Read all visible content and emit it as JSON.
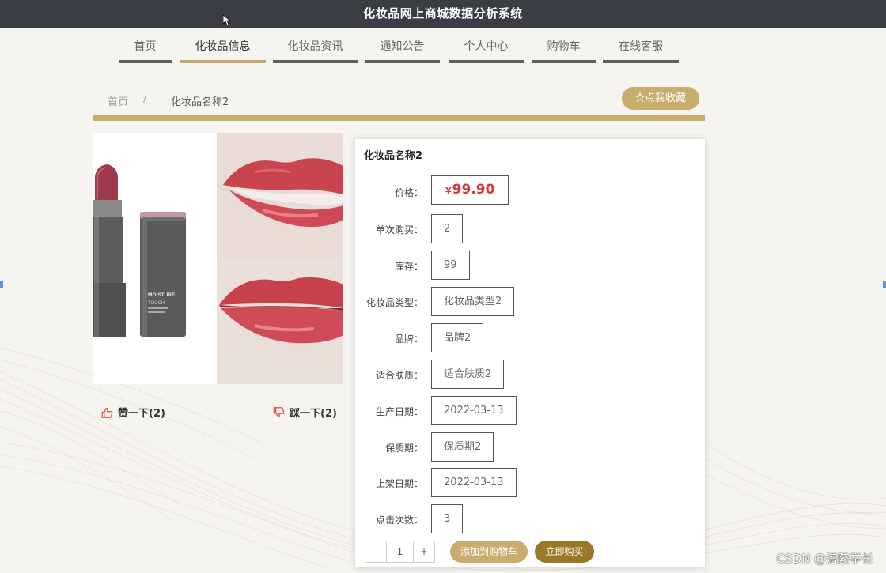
{
  "app": {
    "title": "化妆品网上商城数据分析系统"
  },
  "nav": {
    "items": [
      {
        "label": "首页"
      },
      {
        "label": "化妆品信息"
      },
      {
        "label": "化妆品资讯"
      },
      {
        "label": "通知公告"
      },
      {
        "label": "个人中心"
      },
      {
        "label": "购物车"
      },
      {
        "label": "在线客服"
      }
    ],
    "active_index": 1
  },
  "breadcrumb": {
    "home": "首页",
    "separator": "/",
    "current": "化妆品名称2"
  },
  "favorite_button": {
    "icon": "star-outline-icon",
    "label": "点我收藏"
  },
  "gallery": {
    "left_image": "lipstick-product-photo",
    "right_image": "lips-swatch-photo",
    "product_text": [
      "MOISTURE",
      "TOUCH"
    ]
  },
  "votes": {
    "like": {
      "icon": "thumbs-up-icon",
      "label": "赞一下(2)"
    },
    "dislike": {
      "icon": "thumbs-down-icon",
      "label": "踩一下(2)"
    }
  },
  "product": {
    "name": "化妆品名称2",
    "price": {
      "label": "价格：",
      "currency": "¥",
      "value": "99.90"
    },
    "fields": [
      {
        "label": "单次购买：",
        "value": "2"
      },
      {
        "label": "库存：",
        "value": "99"
      },
      {
        "label": "化妆品类型：",
        "value": "化妆品类型2"
      },
      {
        "label": "品牌：",
        "value": "品牌2"
      },
      {
        "label": "适合肤质：",
        "value": "适合肤质2"
      },
      {
        "label": "生产日期：",
        "value": "2022-03-13"
      },
      {
        "label": "保质期：",
        "value": "保质期2"
      },
      {
        "label": "上架日期：",
        "value": "2022-03-13"
      },
      {
        "label": "点击次数：",
        "value": "3"
      }
    ]
  },
  "purchase": {
    "minus": "-",
    "quantity": "1",
    "plus": "+",
    "add_to_cart": "添加到购物车",
    "buy_now": "立即购买"
  },
  "watermark": "CSDN @涪陵学长",
  "colors": {
    "topbar": "#3a3d44",
    "accent_gold": "#c7ab6b",
    "buy_brown": "#9a7826",
    "price_red": "#d7383a"
  }
}
